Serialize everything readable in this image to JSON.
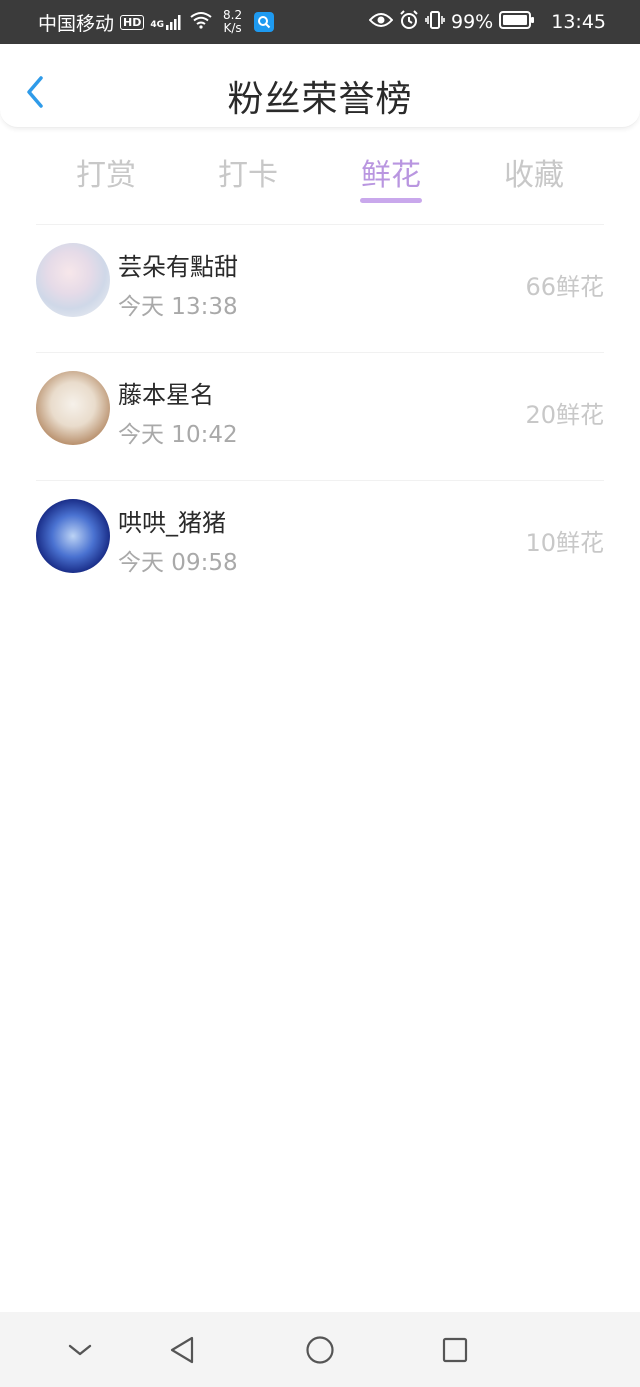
{
  "status_bar": {
    "carrier": "中国移动",
    "hd": "HD",
    "network": "4G",
    "speed_value": "8.2",
    "speed_unit": "K/s",
    "battery": "99%",
    "time": "13:45",
    "icons": [
      "signal-icon",
      "wifi-icon",
      "search-app-icon",
      "eye-icon",
      "alarm-icon",
      "vibrate-icon",
      "battery-icon"
    ]
  },
  "header": {
    "title": "粉丝荣誉榜",
    "back_icon": "chevron-left-icon"
  },
  "tabs": [
    {
      "label": "打赏",
      "active": false
    },
    {
      "label": "打卡",
      "active": false
    },
    {
      "label": "鲜花",
      "active": true
    },
    {
      "label": "收藏",
      "active": false
    }
  ],
  "fans": [
    {
      "name": "芸朵有點甜",
      "time": "今天 13:38",
      "amount": "66鲜花"
    },
    {
      "name": "藤本星名",
      "time": "今天 10:42",
      "amount": "20鲜花"
    },
    {
      "name": "哄哄_猪猪",
      "time": "今天 09:58",
      "amount": "10鲜花"
    }
  ],
  "colors": {
    "accent": "#b996e0",
    "underline": "#c9a8ec",
    "back_arrow": "#2f9be9",
    "status_bar": "#3b3b3b"
  },
  "nav_bar": {
    "icons": [
      "chevron-down-icon",
      "back-triangle-icon",
      "home-circle-icon",
      "recents-square-icon"
    ]
  }
}
